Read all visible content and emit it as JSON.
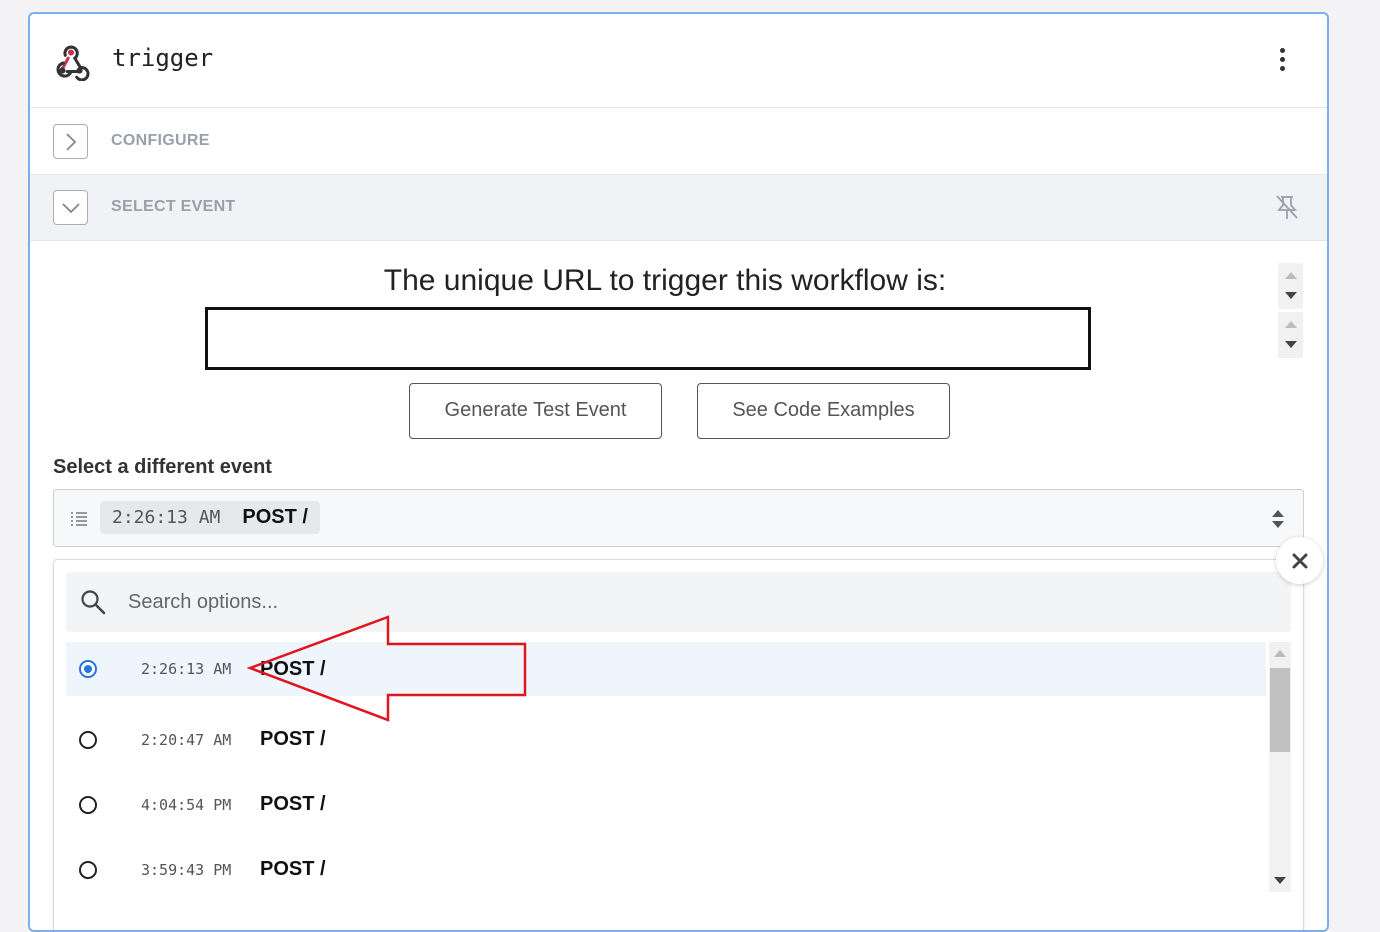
{
  "header": {
    "title": "trigger"
  },
  "sections": {
    "configure": "CONFIGURE",
    "select_event": "SELECT EVENT"
  },
  "url": {
    "heading": "The unique URL to trigger this workflow is:",
    "value": ""
  },
  "buttons": {
    "generate": "Generate Test Event",
    "code_examples": "See Code Examples"
  },
  "select": {
    "label": "Select a different event",
    "selected_time": "2:26:13 AM",
    "selected_request": "POST /",
    "search_placeholder": "Search options..."
  },
  "options": [
    {
      "time": "2:26:13 AM",
      "request": "POST /",
      "selected": true
    },
    {
      "time": "2:20:47 AM",
      "request": "POST /",
      "selected": false
    },
    {
      "time": "4:04:54 PM",
      "request": "POST /",
      "selected": false
    },
    {
      "time": "3:59:43 PM",
      "request": "POST /",
      "selected": false
    }
  ],
  "colors": {
    "accent": "#2a73d9",
    "card_border": "#7ab0e6",
    "logo": "#c4314b",
    "annotation_arrow": "#e0161e"
  },
  "icons": [
    "webhook-icon",
    "kebab-menu-icon",
    "chevron-right-icon",
    "chevron-down-icon",
    "pin-off-icon",
    "list-icon",
    "sort-updown-icon",
    "search-icon",
    "close-icon",
    "annotation-arrow-icon"
  ]
}
